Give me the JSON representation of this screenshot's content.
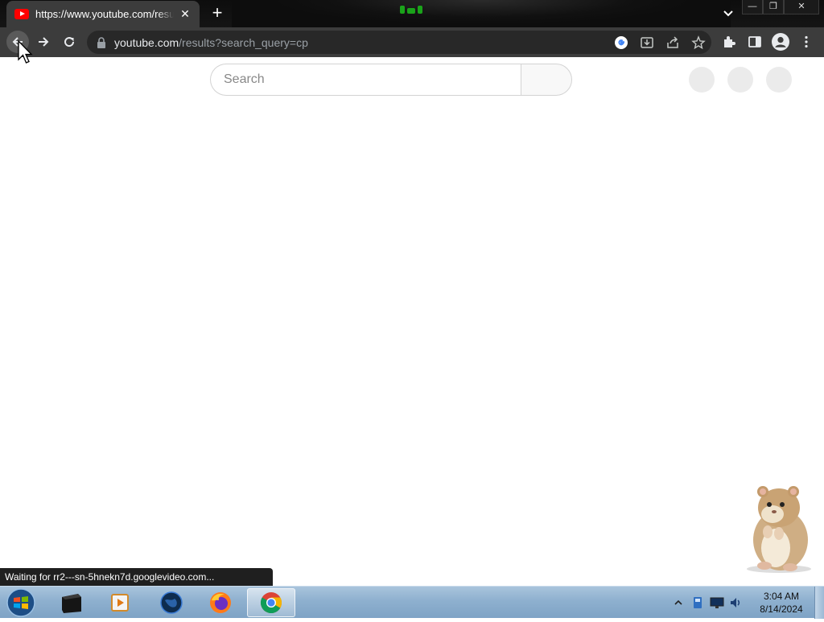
{
  "browser": {
    "tab": {
      "title": "https://www.youtube.com/results?search_query=cp",
      "close_glyph": "✕",
      "favicon": "youtube-icon"
    },
    "new_tab_glyph": "+",
    "window_controls": {
      "minimize": "—",
      "restore": "❐",
      "close": "✕"
    },
    "toolbar": {
      "back": "back-arrow-icon",
      "forward": "forward-arrow-icon",
      "reload": "reload-icon",
      "url_host": "youtube.com",
      "url_path": "/results?search_query=cp",
      "omnibox_icons": [
        "google-lens-icon",
        "install-icon",
        "share-icon",
        "bookmark-star-icon"
      ],
      "right_icons": [
        "extensions-icon",
        "side-panel-icon",
        "profile-icon",
        "menu-icon"
      ]
    },
    "status_text": "Waiting for rr2---sn-5hnekn7d.googlevideo.com..."
  },
  "page": {
    "search_placeholder": "Search",
    "search_value": ""
  },
  "taskbar": {
    "apps": [
      "windows-start-icon",
      "terminal-app-icon",
      "media-player-icon",
      "globe-app-icon",
      "firefox-icon",
      "chrome-icon"
    ],
    "active_app": "chrome",
    "tray_icons": [
      "show-hidden-icons",
      "network-icon",
      "display-icon",
      "volume-icon"
    ],
    "clock_time": "3:04 AM",
    "clock_date": "8/14/2024"
  },
  "colors": {
    "tab_bg": "#3c3c3c",
    "titlebar_bg": "#111111",
    "toolbar_bg": "#3c3c3c",
    "omnibox_bg": "#282828",
    "youtube_red": "#ff0000",
    "taskbar_blue": "#8eb0cf"
  }
}
